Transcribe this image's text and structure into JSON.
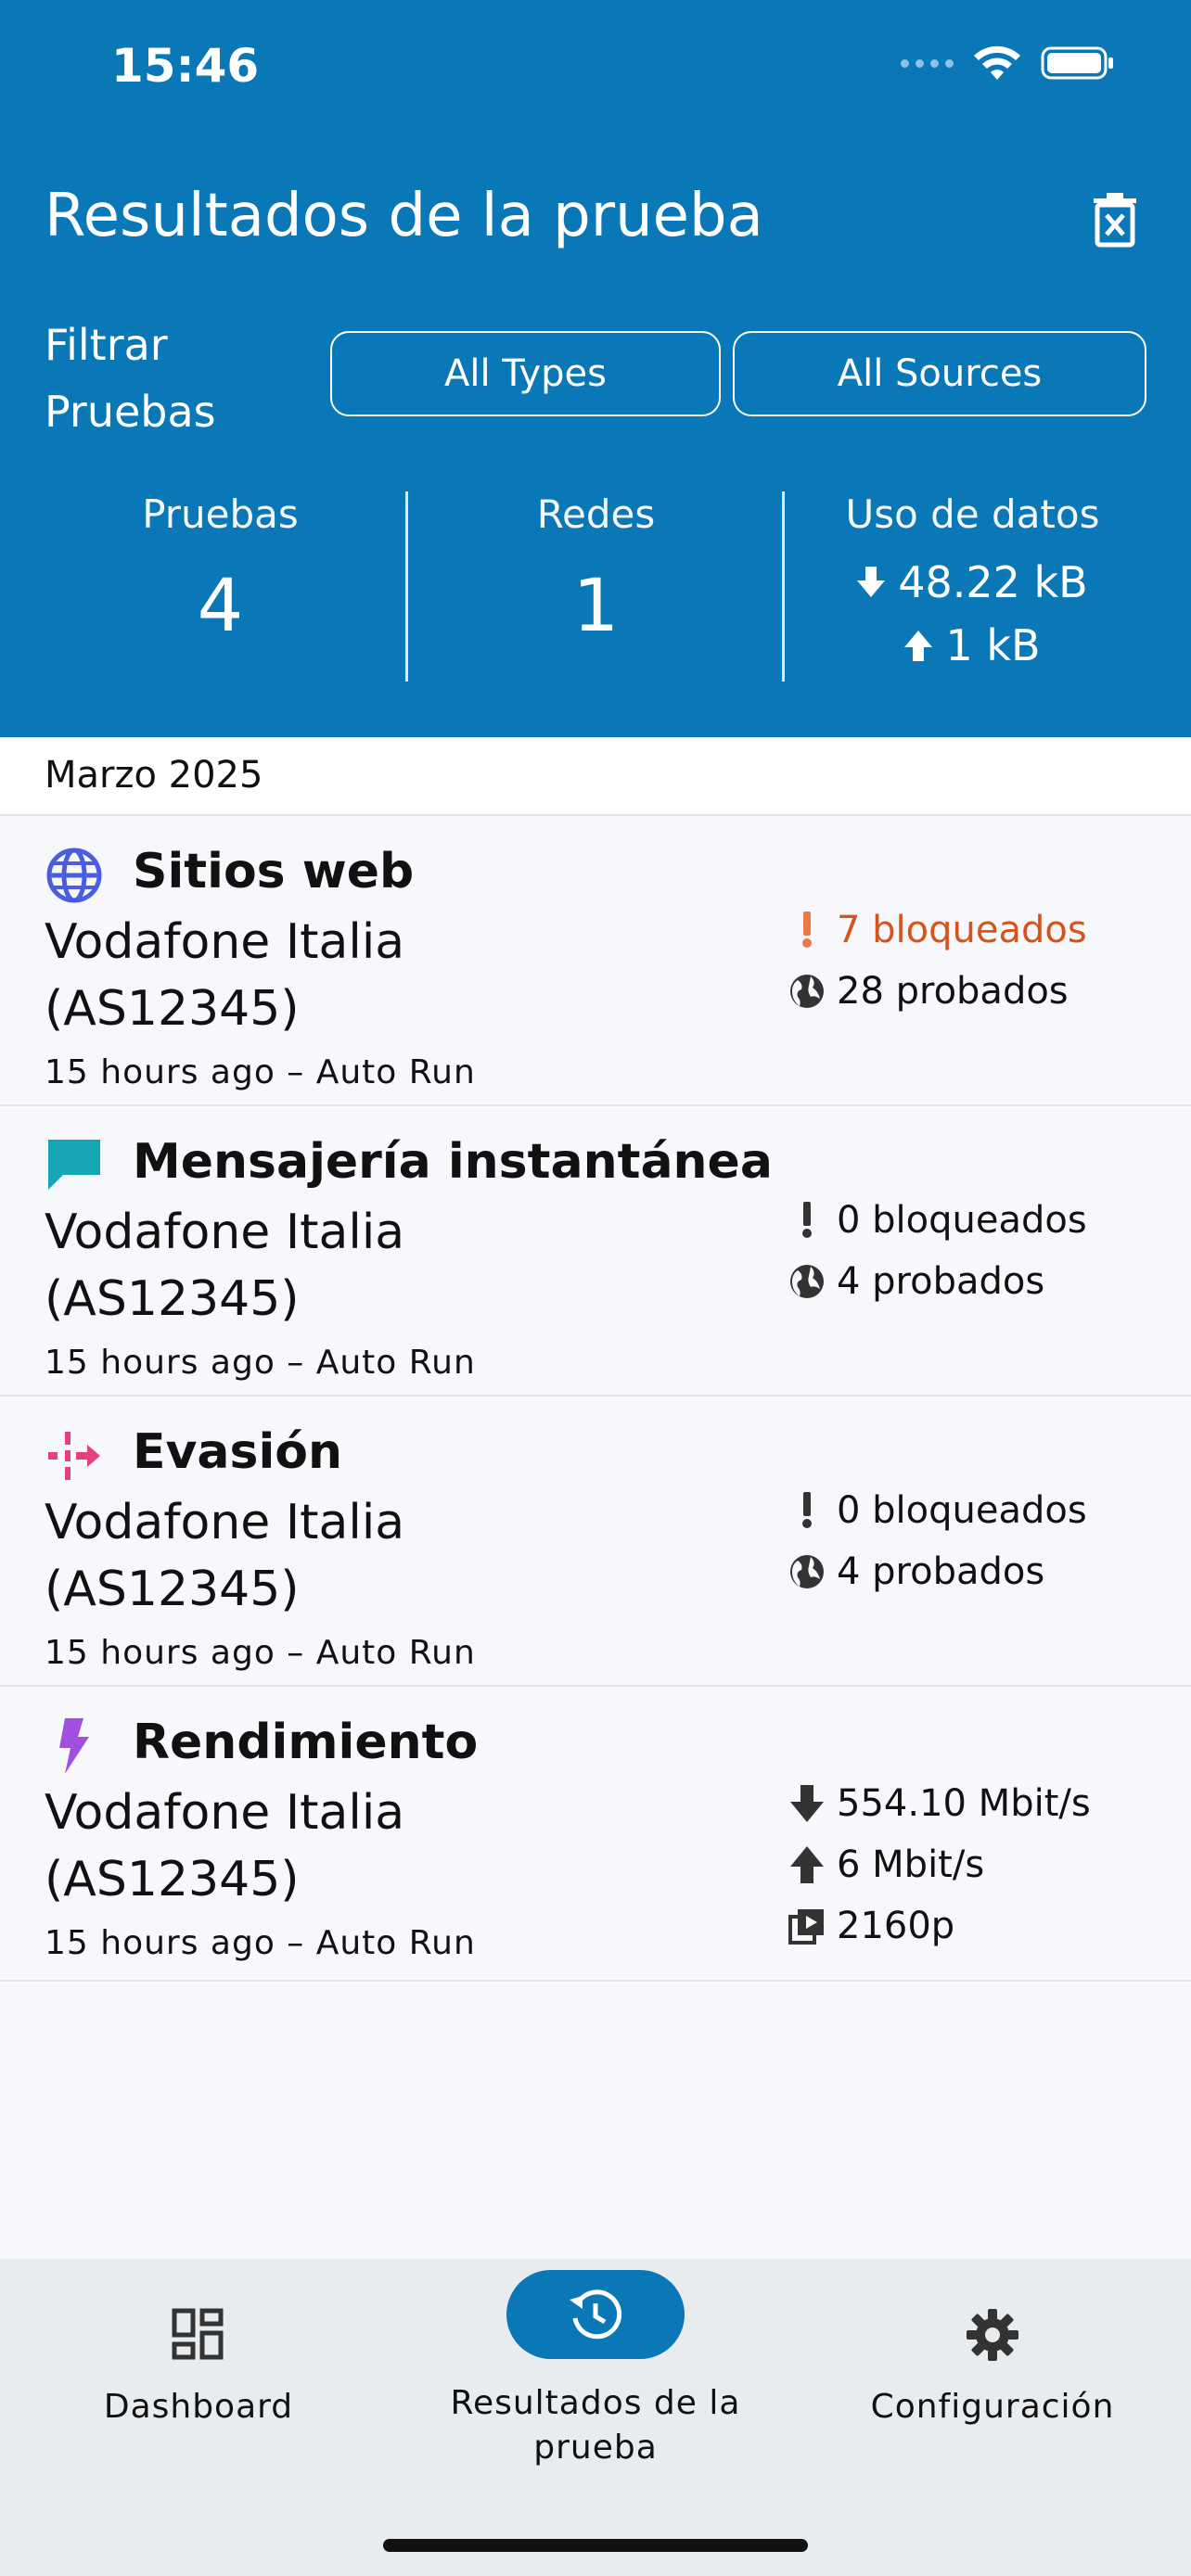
{
  "status_bar": {
    "time": "15:46"
  },
  "header": {
    "title": "Resultados de la prueba",
    "filter_label": "Filtrar Pruebas",
    "filter_types": "All Types",
    "filter_sources": "All Sources"
  },
  "stats": {
    "tests_label": "Pruebas",
    "tests_value": "4",
    "networks_label": "Redes",
    "networks_value": "1",
    "data_label": "Uso de datos",
    "download": "48.22 kB",
    "upload": "1 kB"
  },
  "section": {
    "month": "Marzo 2025"
  },
  "results": [
    {
      "title": "Sitios web",
      "network": "Vodafone Italia (AS12345)",
      "meta": "15 hours ago – Auto Run",
      "blocked": "7 bloqueados",
      "tested": "28 probados",
      "icon": "globe-icon",
      "icon_color": "#4a5de0",
      "blocked_color": "#d4541c"
    },
    {
      "title": "Mensajería instantánea",
      "network": "Vodafone Italia (AS12345)",
      "meta": "15 hours ago – Auto Run",
      "blocked": "0 bloqueados",
      "tested": "4 probados",
      "icon": "chat-icon",
      "icon_color": "#16a6b6"
    },
    {
      "title": "Evasión",
      "network": "Vodafone Italia (AS12345)",
      "meta": "15 hours ago – Auto Run",
      "blocked": "0 bloqueados",
      "tested": "4 probados",
      "icon": "circumvention-icon",
      "icon_color": "#e6417a"
    },
    {
      "title": "Rendimiento",
      "network": "Vodafone Italia (AS12345)",
      "meta": "15 hours ago – Auto Run",
      "download": "554.10 Mbit/s",
      "upload": "6 Mbit/s",
      "video": "2160p",
      "icon": "lightning-icon",
      "icon_color": "#a24fe0"
    }
  ],
  "nav": {
    "dashboard": "Dashboard",
    "results": "Resultados de la prueba",
    "settings": "Configuración"
  }
}
